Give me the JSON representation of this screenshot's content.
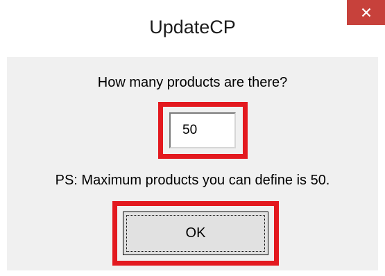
{
  "window": {
    "title": "UpdateCP",
    "close_icon": "close-icon"
  },
  "dialog": {
    "prompt": "How many products are there?",
    "input_value": "50",
    "note": "PS: Maximum products you can define is 50.",
    "ok_label": "OK"
  },
  "colors": {
    "close_button": "#c7413b",
    "highlight": "#e3191f",
    "client_area": "#f0f0f0",
    "button_face": "#e1e1e1"
  }
}
